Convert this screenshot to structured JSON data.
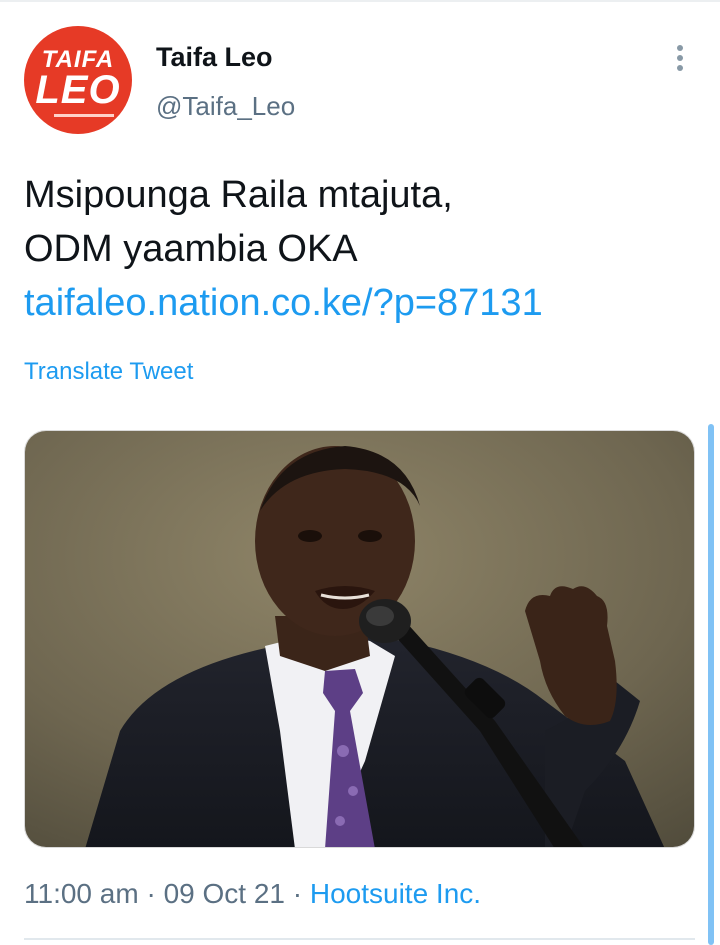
{
  "account": {
    "display_name": "Taifa Leo",
    "handle": "@Taifa_Leo",
    "avatar_logo_line1": "TAIFA",
    "avatar_logo_line2": "LEO",
    "avatar_color": "#e63a26"
  },
  "tweet": {
    "text_lines": [
      "Msipounga Raila mtajuta,",
      "ODM yaambia OKA"
    ],
    "link": "taifaleo.nation.co.ke/?p=87131",
    "translate_label": "Translate Tweet"
  },
  "media": {
    "icon": "photo-of-speaker-at-microphone"
  },
  "meta": {
    "time": "11:00 am",
    "date": "09 Oct 21",
    "separator": "·",
    "source": "Hootsuite Inc."
  },
  "colors": {
    "link": "#1d9bf0",
    "secondary_text": "#5b7083",
    "primary_text": "#0f1419"
  },
  "icons": {
    "more": "more-vertical-icon"
  }
}
